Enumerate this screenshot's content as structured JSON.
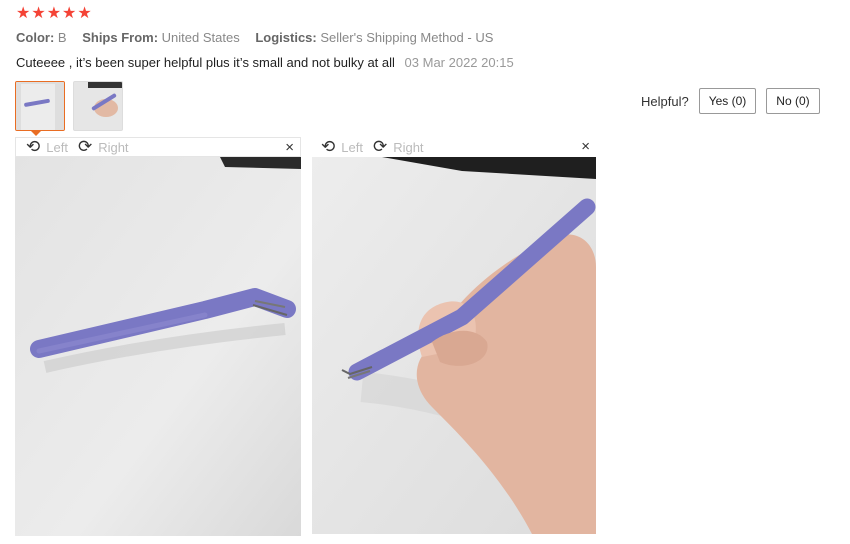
{
  "rating": {
    "stars": 5,
    "color": "#f44336",
    "star_glyph": "★"
  },
  "meta": {
    "color_label": "Color:",
    "color_value": "B",
    "ships_label": "Ships From:",
    "ships_value": "United States",
    "logistics_label": "Logistics:",
    "logistics_value": "Seller's Shipping Method - US"
  },
  "review": {
    "text": "Cuteeee , it’s been super helpful plus it’s small and not bulky at all",
    "date": "03 Mar 2022 20:15"
  },
  "helpful": {
    "label": "Helpful?",
    "yes": "Yes (0)",
    "no": "No (0)"
  },
  "viewer": {
    "left": "Left",
    "right": "Right",
    "close": "×",
    "rotate_left_icon": "⟲",
    "rotate_right_icon": "⟳"
  },
  "colors": {
    "accent": "#e96d23",
    "tweezers": "#7a78c4"
  }
}
